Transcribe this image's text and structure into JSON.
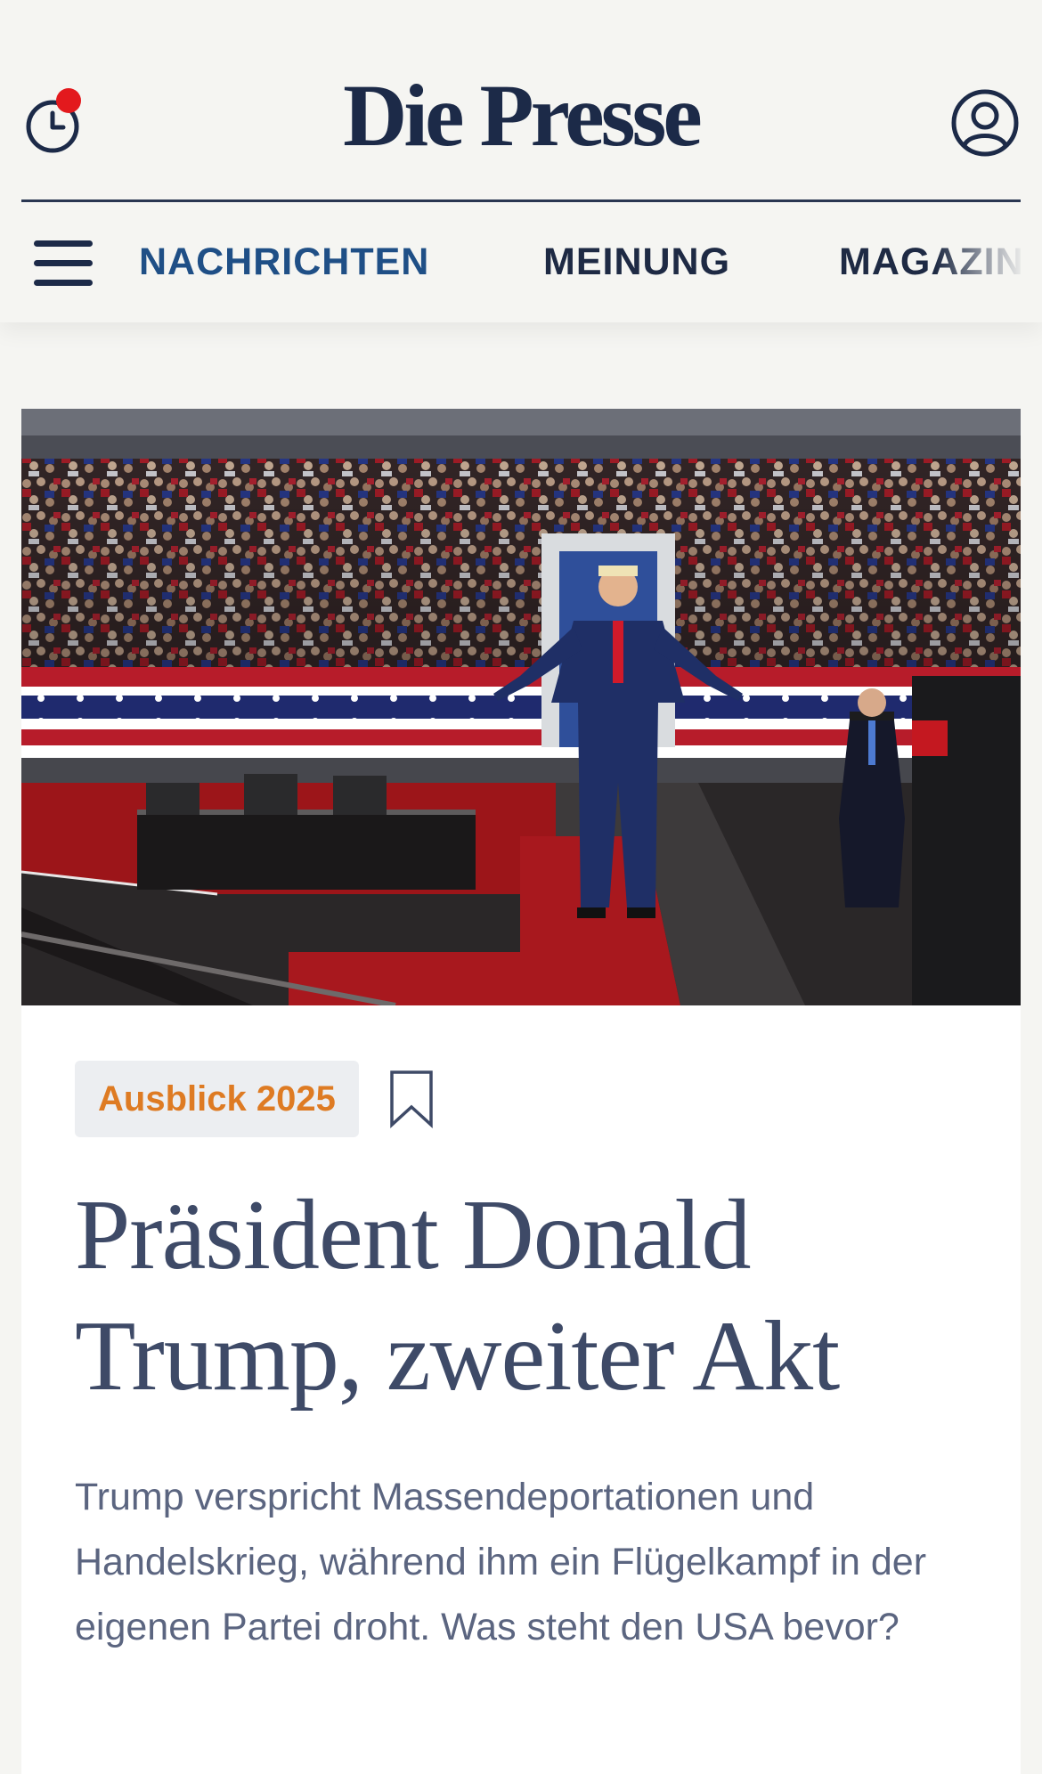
{
  "header": {
    "logo": "Die Presse",
    "recent_icon": "clock-icon",
    "notification_dot_color": "#e3191d",
    "account_icon": "user-icon",
    "menu_icon": "hamburger-menu-icon"
  },
  "nav": {
    "items": [
      {
        "label": "NACHRICHTEN",
        "active": true
      },
      {
        "label": "MEINUNG",
        "active": false
      },
      {
        "label": "MAGAZIN",
        "active": false
      }
    ]
  },
  "article": {
    "kicker": "Ausblick 2025",
    "bookmark_icon": "bookmark-icon",
    "headline": "Präsident Donald Trump, zweiter Akt",
    "lead": "Trump verspricht Massendeportationen und Handelskrieg, während ihm ein Flügelkampf in der eigenen Partei droht. Was steht den USA bevor?"
  },
  "colors": {
    "brand_navy": "#1c2a48",
    "nav_active": "#1f4f86",
    "kicker_orange": "#de7b23",
    "background": "#f5f5f2"
  }
}
